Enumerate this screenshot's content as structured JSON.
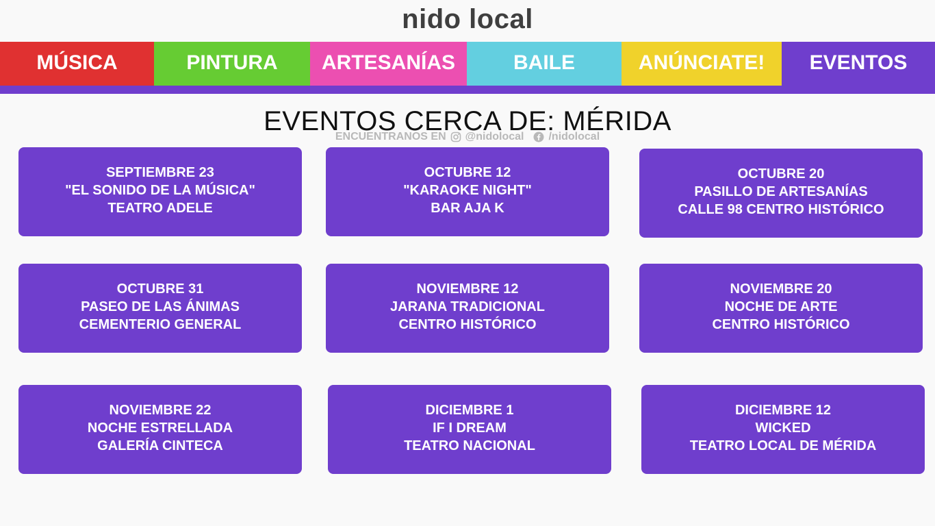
{
  "brand": {
    "logo_text": "nido local"
  },
  "nav": [
    {
      "label": "MÚSICA",
      "color": "#e03131"
    },
    {
      "label": "PINTURA",
      "color": "#66cc33"
    },
    {
      "label": "ARTESANÍAS",
      "color": "#ec4fb1"
    },
    {
      "label": "BAILE",
      "color": "#63cfe0"
    },
    {
      "label": "ANÚNCIATE!",
      "color": "#f0d22b"
    },
    {
      "label": "EVENTOS",
      "color": "#6f3ecd"
    }
  ],
  "page_title": "EVENTOS CERCA DE: MÉRIDA",
  "social": {
    "prefix": "ENCUENTRANOS EN",
    "instagram_icon": "instagram-icon",
    "instagram_handle": "@nidolocal",
    "facebook_icon": "facebook-icon",
    "facebook_handle": "/nidolocal"
  },
  "events": [
    {
      "date": "SEPTIEMBRE 23",
      "name": "\"EL SONIDO DE LA MÚSICA\"",
      "venue": "TEATRO ADELE"
    },
    {
      "date": "OCTUBRE 12",
      "name": "\"KARAOKE NIGHT\"",
      "venue": "BAR AJA K"
    },
    {
      "date": "OCTUBRE 20",
      "name": "PASILLO DE ARTESANÍAS",
      "venue": "CALLE 98 CENTRO HISTÓRICO"
    },
    {
      "date": "OCTUBRE 31",
      "name": "PASEO DE LAS ÁNIMAS",
      "venue": "CEMENTERIO GENERAL"
    },
    {
      "date": "NOVIEMBRE 12",
      "name": "JARANA TRADICIONAL",
      "venue": "CENTRO HISTÓRICO"
    },
    {
      "date": "NOVIEMBRE 20",
      "name": "NOCHE DE ARTE",
      "venue": "CENTRO HISTÓRICO"
    },
    {
      "date": "NOVIEMBRE 22",
      "name": "NOCHE ESTRELLADA",
      "venue": "GALERÍA CINTECA"
    },
    {
      "date": "DICIEMBRE 1",
      "name": "IF I DREAM",
      "venue": "TEATRO NACIONAL"
    },
    {
      "date": "DICIEMBRE 12",
      "name": "WICKED",
      "venue": "TEATRO LOCAL DE MÉRIDA"
    }
  ],
  "colors": {
    "accent": "#6f3ecd",
    "background": "#f9f9f9"
  }
}
